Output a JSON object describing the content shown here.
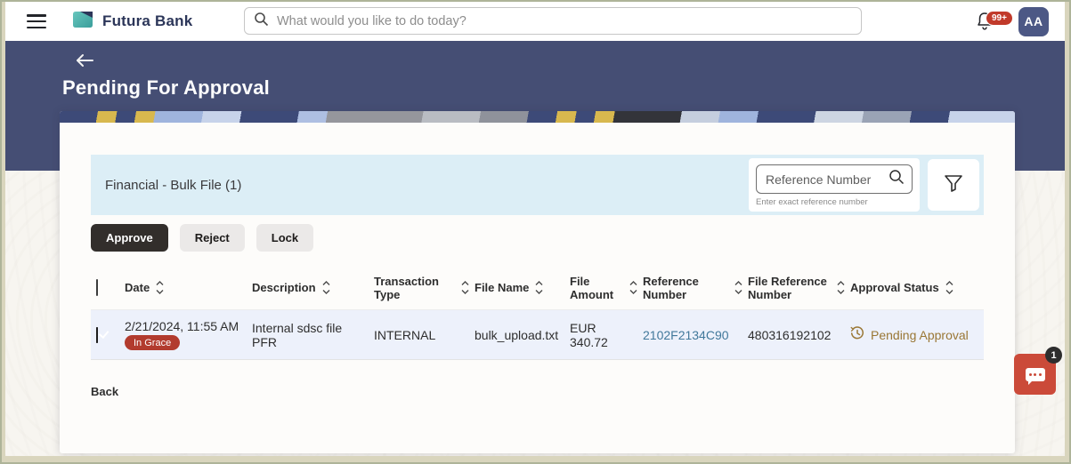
{
  "topbar": {
    "brand": "Futura Bank",
    "search_placeholder": "What would you like to do today?",
    "notification_count": "99+",
    "avatar_initials": "AA"
  },
  "header": {
    "title": "Pending For Approval"
  },
  "filter_bar": {
    "section_title": "Financial - Bulk File (1)",
    "reference_placeholder": "Reference Number",
    "reference_helper": "Enter exact reference number"
  },
  "actions": {
    "approve_label": "Approve",
    "reject_label": "Reject",
    "lock_label": "Lock"
  },
  "table": {
    "columns": [
      "Date",
      "Description",
      "Transaction Type",
      "File Name",
      "File Amount",
      "Reference Number",
      "File Reference Number",
      "Approval Status"
    ],
    "rows": [
      {
        "date": "2/21/2024, 11:55 AM",
        "grace_badge": "In Grace",
        "description": "Internal sdsc file PFR",
        "transaction_type": "INTERNAL",
        "file_name": "bulk_upload.txt",
        "file_amount": "EUR 340.72",
        "reference_number": "2102F2134C90",
        "file_reference_number": "480316192102",
        "approval_status": "Pending Approval"
      }
    ]
  },
  "footer": {
    "back_label": "Back"
  },
  "chat": {
    "unread_count": "1"
  },
  "colors": {
    "hero_navy": "#454e74",
    "filter_bar_blue": "#dceef6",
    "row_highlight": "#edf1fb",
    "grace_badge_red": "#b23b2e",
    "link_blue": "#41789b",
    "status_gold": "#9a7735",
    "chat_red": "#cb4a39",
    "approve_dark": "#322e2b"
  }
}
